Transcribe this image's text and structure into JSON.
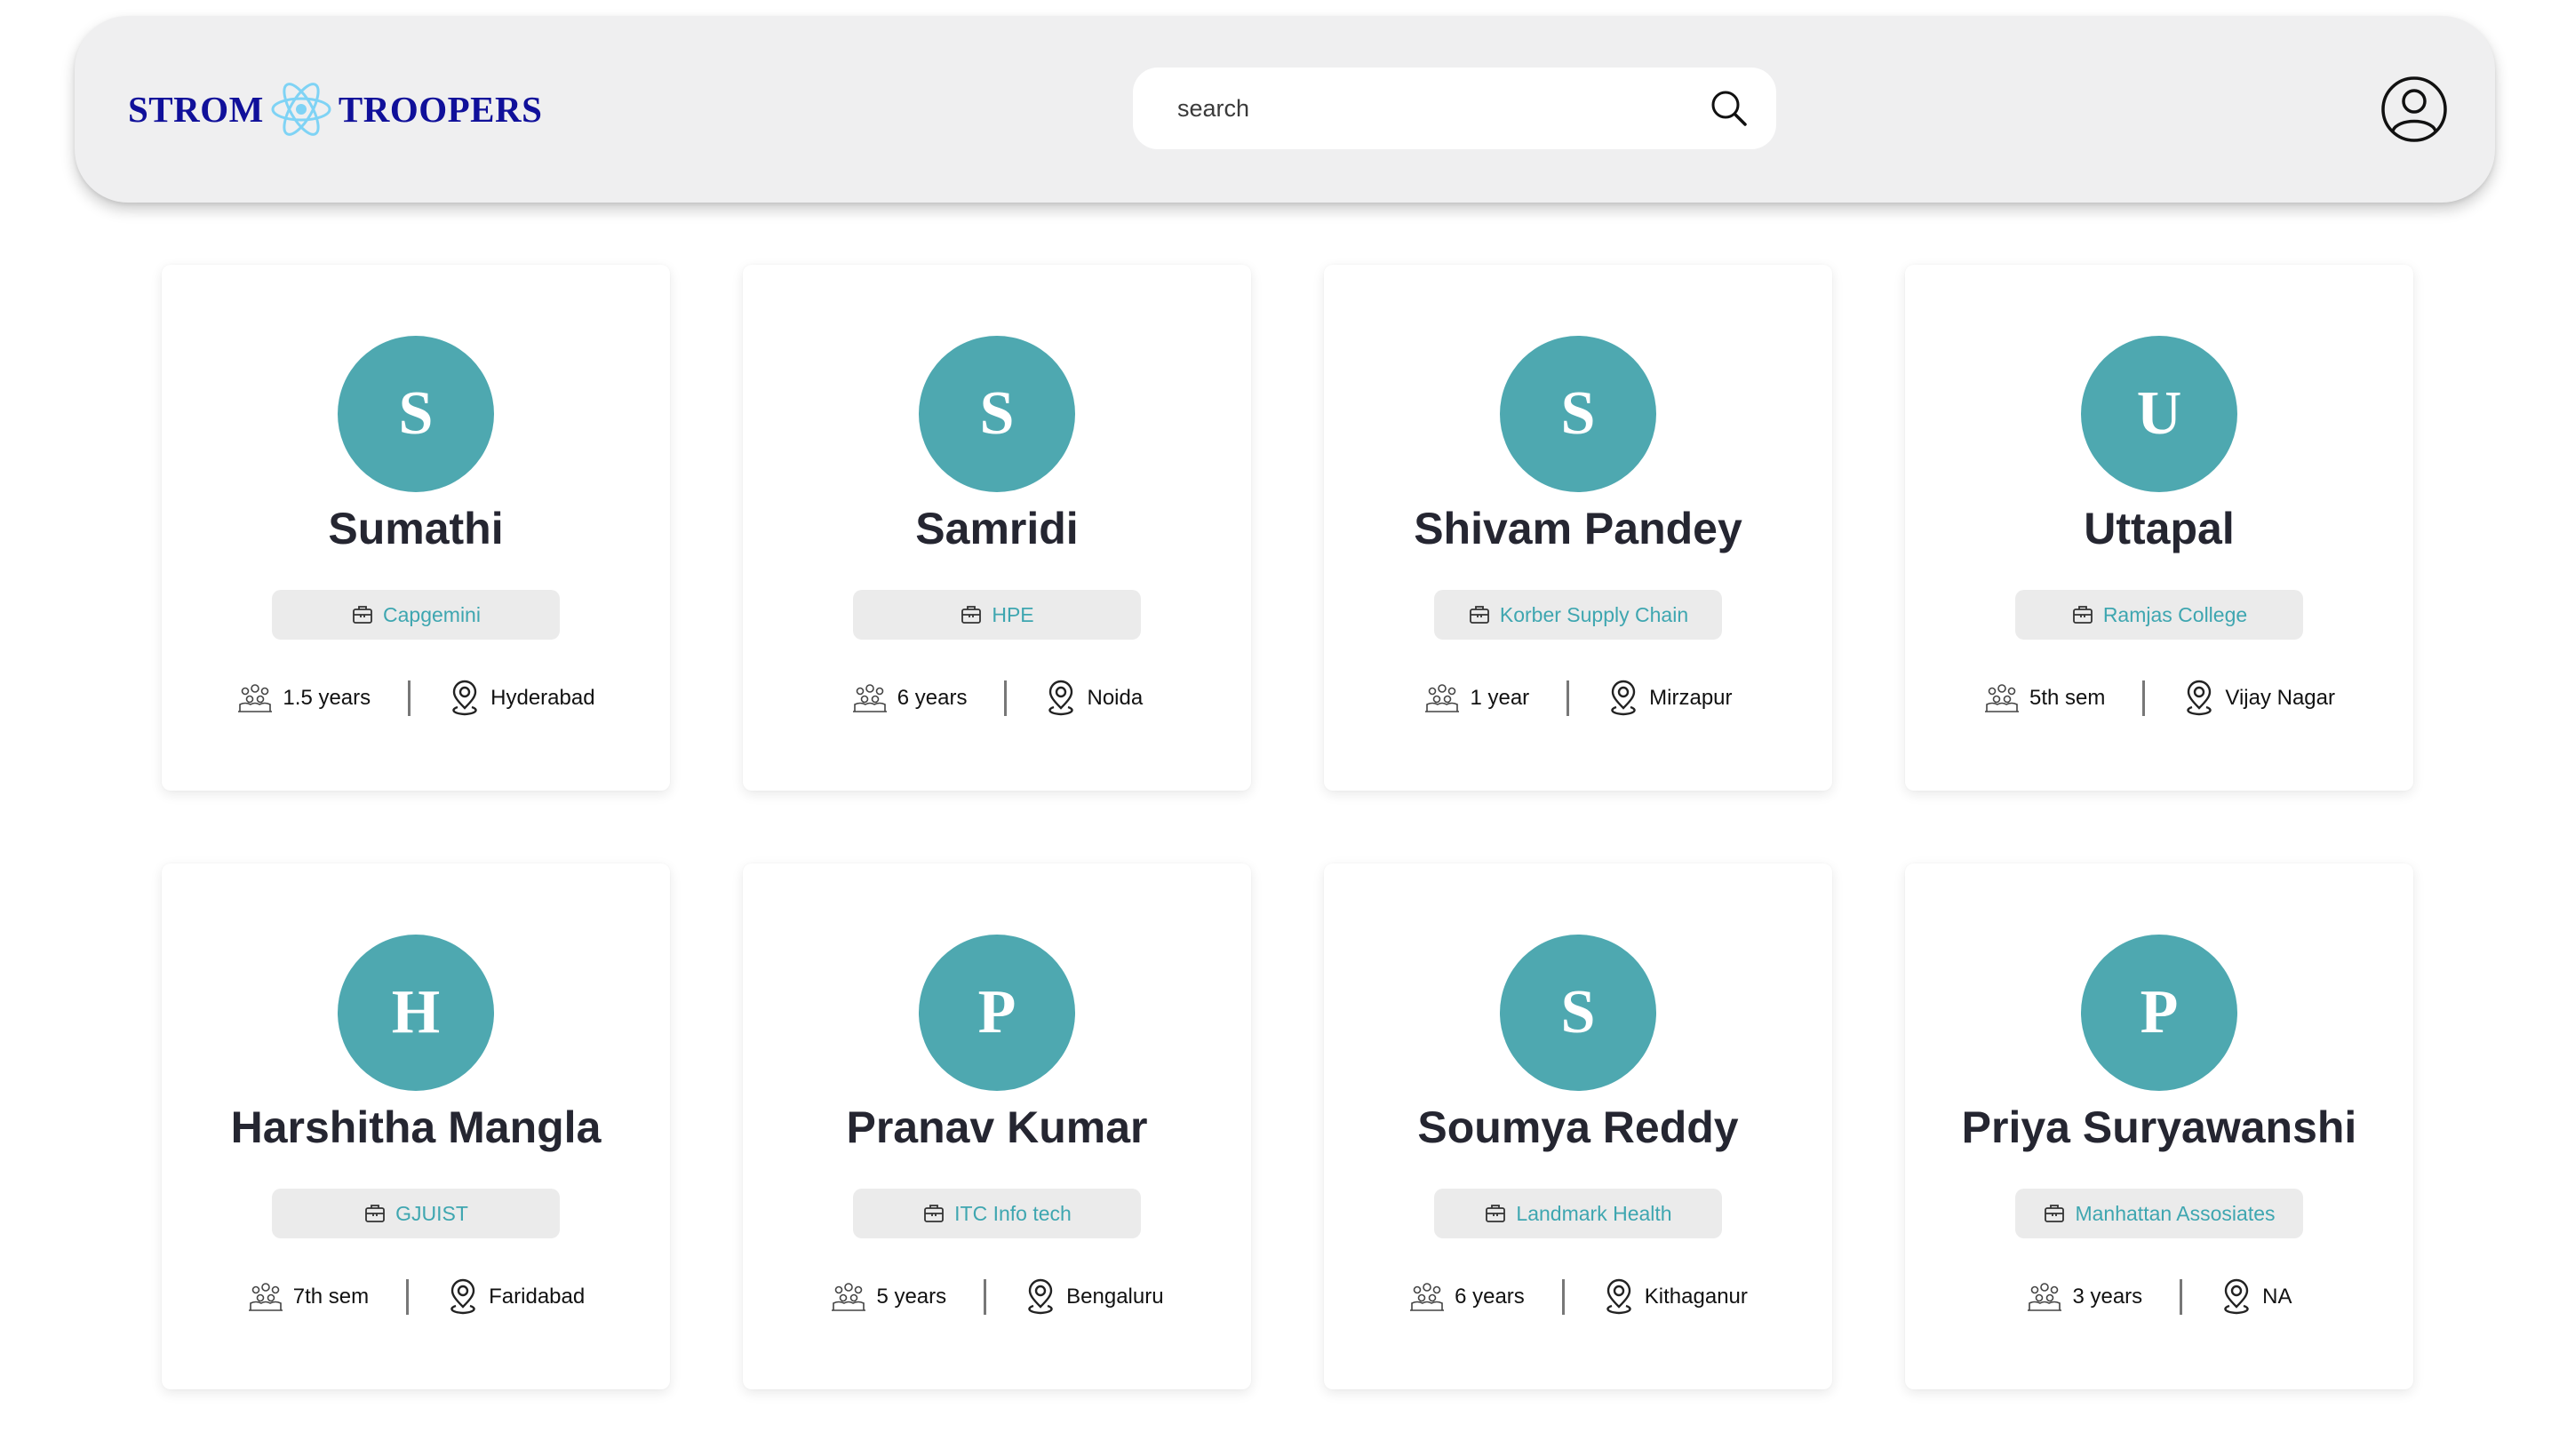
{
  "header": {
    "brand_left": "STROM",
    "brand_right": "TROOPERS",
    "logo_icon": "react-atom-icon",
    "search_placeholder": "search",
    "search_icon": "search-icon",
    "profile_icon": "user-circle-icon"
  },
  "colors": {
    "brand": "#10109a",
    "accent": "#4ea8b0",
    "company_text": "#3ea6b0",
    "header_bg": "#efeff0"
  },
  "cards": [
    {
      "initial": "S",
      "name": "Sumathi",
      "company": "Capgemini",
      "experience": "1.5 years",
      "location": "Hyderabad"
    },
    {
      "initial": "S",
      "name": "Samridi",
      "company": "HPE",
      "experience": "6 years",
      "location": "Noida"
    },
    {
      "initial": "S",
      "name": "Shivam Pandey",
      "company": "Korber Supply Chain",
      "experience": "1 year",
      "location": "Mirzapur"
    },
    {
      "initial": "U",
      "name": "Uttapal",
      "company": "Ramjas College",
      "experience": "5th sem",
      "location": "Vijay Nagar"
    },
    {
      "initial": "H",
      "name": "Harshitha Mangla",
      "company": "GJUIST",
      "experience": "7th sem",
      "location": "Faridabad"
    },
    {
      "initial": "P",
      "name": "Pranav Kumar",
      "company": "ITC Info tech",
      "experience": "5 years",
      "location": "Bengaluru"
    },
    {
      "initial": "S",
      "name": "Soumya Reddy",
      "company": "Landmark Health",
      "experience": "6 years",
      "location": "Kithaganur"
    },
    {
      "initial": "P",
      "name": "Priya Suryawanshi",
      "company": "Manhattan Assosiates",
      "experience": "3 years",
      "location": "NA"
    }
  ]
}
